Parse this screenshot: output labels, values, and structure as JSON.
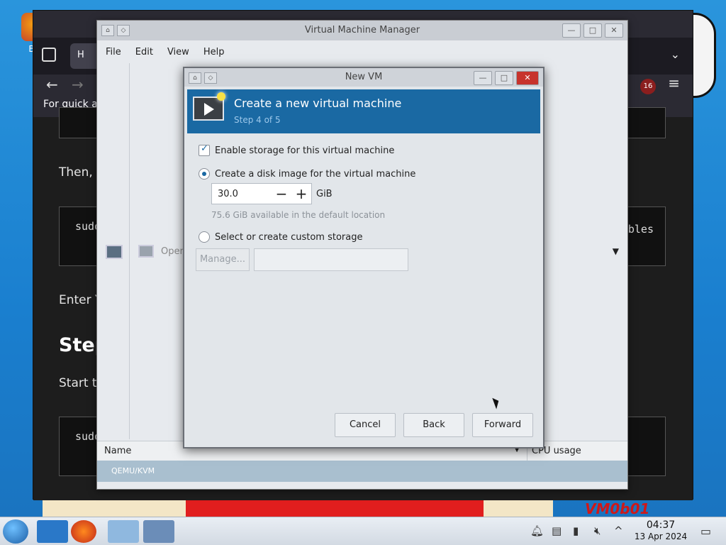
{
  "desktop": {
    "icon_label": "Big",
    "deco_text": "VM0b01"
  },
  "browser": {
    "tab_label": "H",
    "quick_text": "For quick ac",
    "badge": "16",
    "paragraphs": [
      "Then, r",
      "Enter Y",
      "Start th"
    ],
    "heading": "Step",
    "code_boxes": [
      "sudo",
      "sudo"
    ],
    "right_fragment": "ables"
  },
  "vmm": {
    "title": "Virtual Machine Manager",
    "menu": [
      "File",
      "Edit",
      "View",
      "Help"
    ],
    "open_label": "Open",
    "col_name": "Name",
    "col_cpu": "CPU usage",
    "connection": "QEMU/KVM"
  },
  "dialog": {
    "title": "New VM",
    "header_title": "Create a new virtual machine",
    "header_step": "Step 4 of 5",
    "enable_storage": "Enable storage for this virtual machine",
    "create_disk": "Create a disk image for the virtual machine",
    "disk_size": "30.0",
    "unit": "GiB",
    "available": "75.6 GiB available in the default location",
    "custom_storage": "Select or create custom storage",
    "manage": "Manage...",
    "buttons": {
      "cancel": "Cancel",
      "back": "Back",
      "forward": "Forward"
    }
  },
  "taskbar": {
    "time": "04:37",
    "date": "13 Apr 2024"
  }
}
